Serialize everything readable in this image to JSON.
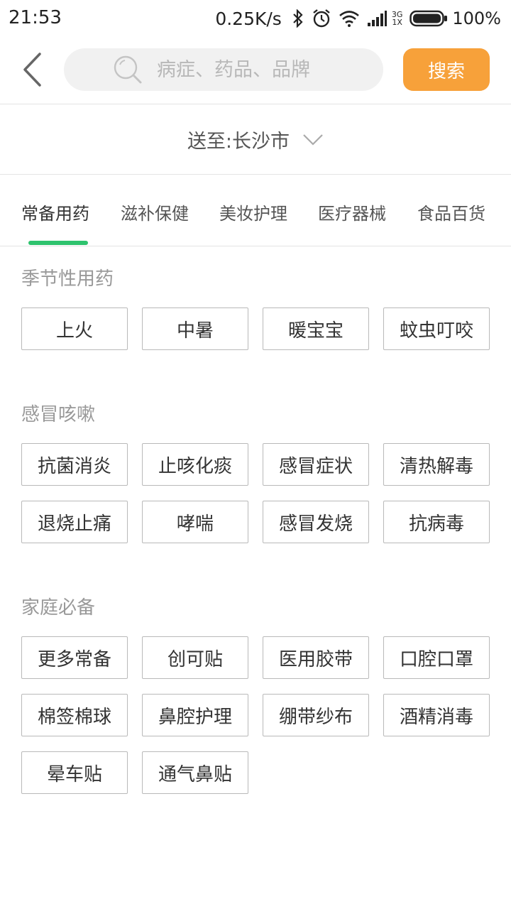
{
  "status_bar": {
    "time": "21:53",
    "speed": "0.25K/s",
    "network_top": "3G",
    "network_bottom": "1X",
    "battery": "100%"
  },
  "header": {
    "search_placeholder": "病症、药品、品牌",
    "search_button": "搜索"
  },
  "delivery": {
    "label": "送至:长沙市"
  },
  "tabs": [
    {
      "label": "常备用药",
      "active": true
    },
    {
      "label": "滋补保健",
      "active": false
    },
    {
      "label": "美妆护理",
      "active": false
    },
    {
      "label": "医疗器械",
      "active": false
    },
    {
      "label": "食品百货",
      "active": false
    }
  ],
  "sections": [
    {
      "title": "季节性用药",
      "items": [
        "上火",
        "中暑",
        "暖宝宝",
        "蚊虫叮咬"
      ]
    },
    {
      "title": "感冒咳嗽",
      "items": [
        "抗菌消炎",
        "止咳化痰",
        "感冒症状",
        "清热解毒",
        "退烧止痛",
        "哮喘",
        "感冒发烧",
        "抗病毒"
      ]
    },
    {
      "title": "家庭必备",
      "items": [
        "更多常备",
        "创可贴",
        "医用胶带",
        "口腔口罩",
        "棉签棉球",
        "鼻腔护理",
        "绷带纱布",
        "酒精消毒",
        "晕车贴",
        "通气鼻贴"
      ]
    }
  ],
  "colors": {
    "accent_orange": "#f7a13a",
    "tab_indicator_green": "#2ec36e"
  }
}
